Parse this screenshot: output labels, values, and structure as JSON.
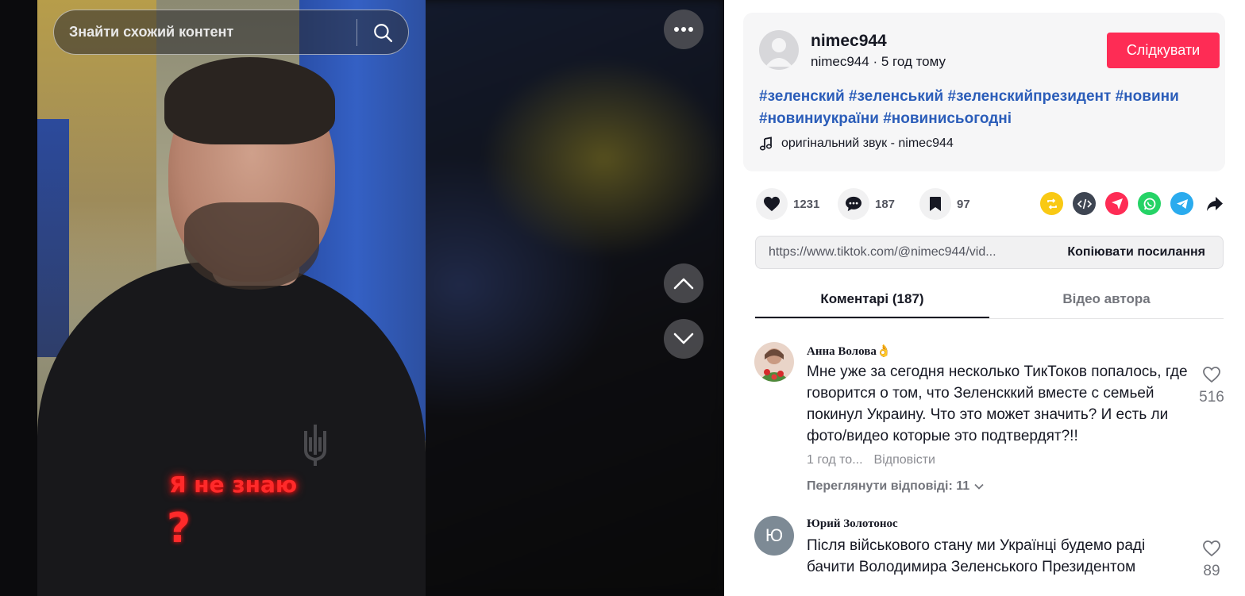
{
  "search": {
    "placeholder": "Знайти схожий контент"
  },
  "video": {
    "caption_text": "Я не знаю",
    "caption_mark": "?"
  },
  "author": {
    "username": "nimec944",
    "handle": "nimec944",
    "separator": "·",
    "posted": "5 год тому",
    "follow_label": "Слідкувати"
  },
  "description": {
    "hashtags": [
      "#зеленский",
      "#зеленський",
      "#зеленскийпрезидент",
      "#новини",
      "#новиниукраїни",
      "#новинисьогодні"
    ]
  },
  "music": {
    "label": "оригінальний звук - nimec944"
  },
  "stats": {
    "likes": "1231",
    "comments": "187",
    "saves": "97"
  },
  "share": {
    "icons": [
      "repost-icon",
      "embed-icon",
      "send-icon",
      "whatsapp-icon",
      "telegram-icon",
      "share-arrow-icon"
    ],
    "colors": {
      "repost": "#f9c914",
      "embed": "#3e4552",
      "send": "#fe2c55",
      "whatsapp": "#25d366",
      "telegram": "#2aabee"
    }
  },
  "link": {
    "url": "https://www.tiktok.com/@nimec944/vid...",
    "copy_label": "Копіювати посилання"
  },
  "tabs": [
    {
      "label": "Коментарі (187)",
      "active": true
    },
    {
      "label": "Відео автора",
      "active": false
    }
  ],
  "comments": [
    {
      "author": "Анна Волова👌",
      "text": "Мне уже за сегодня несколько ТикТоков попалось, где говорится о том, что Зеленсккий вместе с семьей покинул Украину. Что это может значить? И есть ли фото/видео которые это подтвердят?!!",
      "time": "1 год то...",
      "reply_label": "Відповісти",
      "view_replies": "Переглянути відповіді: 11",
      "likes": "516"
    },
    {
      "author": "Юрий Золотонос",
      "avatar_letter": "Ю",
      "text": "Після військового стану ми Українці будемо раді бачити Володимира Зеленського Президентом",
      "likes": "89"
    }
  ],
  "accent_color": "#fe2c55"
}
